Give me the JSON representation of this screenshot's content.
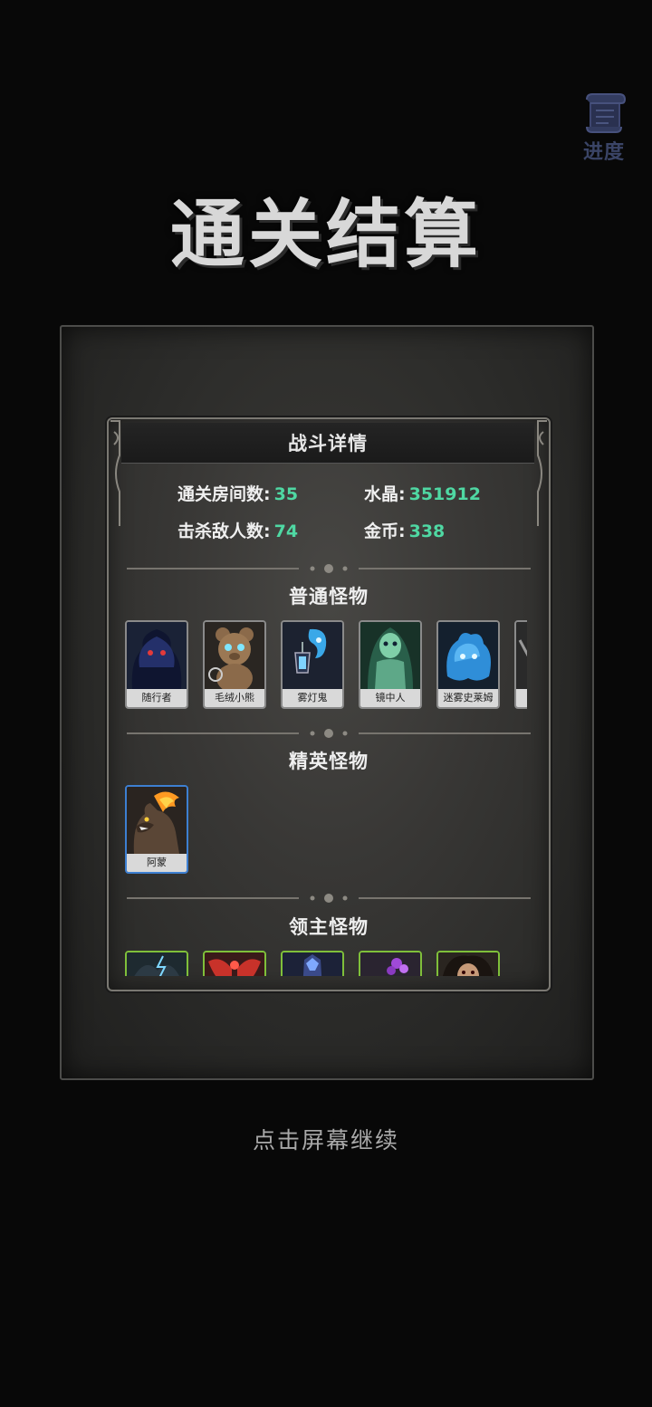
{
  "progress_button": {
    "label": "进度",
    "icon": "scroll-icon"
  },
  "title": "通关结算",
  "panel": {
    "header": "战斗详情",
    "stats": {
      "rooms_label": "通关房间数:",
      "rooms_value": "35",
      "crystal_label": "水晶:",
      "crystal_value": "351912",
      "kills_label": "击杀敌人数:",
      "kills_value": "74",
      "gold_label": "金币:",
      "gold_value": "338"
    },
    "sections": [
      {
        "title": "普通怪物",
        "cards": [
          {
            "name": "随行者",
            "icon": "shadow-follower-icon"
          },
          {
            "name": "毛绒小熊",
            "icon": "teddy-bear-icon"
          },
          {
            "name": "雾灯鬼",
            "icon": "lantern-ghost-icon"
          },
          {
            "name": "镜中人",
            "icon": "mirror-ghost-icon"
          },
          {
            "name": "迷雾史莱姆",
            "icon": "mist-slime-icon"
          },
          {
            "name": "",
            "icon": "partial-card-icon"
          }
        ]
      },
      {
        "title": "精英怪物",
        "cards": [
          {
            "name": "阿蒙",
            "icon": "fire-wolf-icon"
          }
        ]
      },
      {
        "title": "领主怪物",
        "cards": [
          {
            "name": "",
            "icon": "lightning-beast-icon"
          },
          {
            "name": "",
            "icon": "crimson-moth-icon"
          },
          {
            "name": "",
            "icon": "frost-knight-icon"
          },
          {
            "name": "",
            "icon": "purple-flora-icon"
          },
          {
            "name": "",
            "icon": "wild-hair-lord-icon"
          }
        ]
      }
    ]
  },
  "continue_prompt": "点击屏幕继续",
  "colors": {
    "accent_value": "#4fd8a3",
    "elite_border": "#3d7fd1",
    "boss_border": "#7fbf3a"
  }
}
